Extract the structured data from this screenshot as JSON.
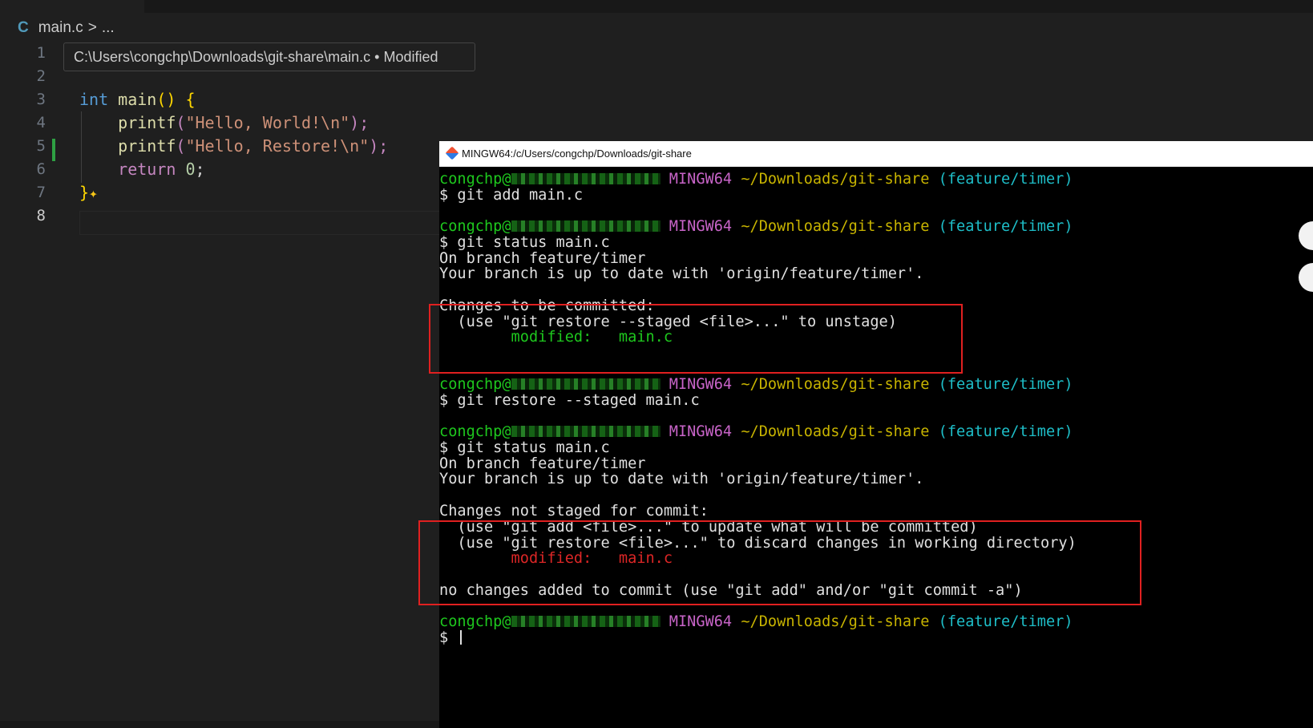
{
  "editor": {
    "breadcrumb": {
      "lang_icon": "C",
      "file": "main.c",
      "separator": ">",
      "ellipsis": "..."
    },
    "hover_tooltip": "C:\\Users\\congchp\\Downloads\\git-share\\main.c • Modified",
    "line_numbers": [
      "1",
      "2",
      "3",
      "4",
      "5",
      "6",
      "7",
      "8"
    ],
    "active_line": "8",
    "code": {
      "l3": {
        "kw": "int",
        "fn": "main",
        "rest": "() {"
      },
      "l4": {
        "fn": "printf",
        "open": "(",
        "str": "\"Hello, World!\\n\"",
        "close": ");"
      },
      "l5": {
        "fn": "printf",
        "open": "(",
        "str": "\"Hello, Restore!\\n\"",
        "close": ");"
      },
      "l6": {
        "kw": "return",
        "num": "0",
        "end": ";"
      },
      "l7": {
        "brace": "}",
        "sparkle_icon": "sparkle-icon"
      }
    }
  },
  "terminal": {
    "title": "MINGW64:/c/Users/congchp/Downloads/git-share",
    "prompt": {
      "user": "congchp@",
      "host_label": "MINGW64",
      "path": "~/Downloads/git-share",
      "branch": "(feature/timer)"
    },
    "lines": {
      "cmd1": "$ git add main.c",
      "cmd2": "$ git status main.c",
      "on_branch_1": "On branch feature/timer",
      "up_to_date_1": "Your branch is up to date with 'origin/feature/timer'.",
      "staged_header": "Changes to be committed:",
      "staged_hint": "  (use \"git restore --staged <file>...\" to unstage)",
      "staged_modified_label": "        modified:",
      "staged_modified_file": "   main.c",
      "cmd3": "$ git restore --staged main.c",
      "cmd4": "$ git status main.c",
      "on_branch_2": "On branch feature/timer",
      "up_to_date_2": "Your branch is up to date with 'origin/feature/timer'.",
      "unstaged_header": "Changes not staged for commit:",
      "unstaged_hint1": "  (use \"git add <file>...\" to update what will be committed)",
      "unstaged_hint2": "  (use \"git restore <file>...\" to discard changes in working directory)",
      "unstaged_modified_label": "        modified:",
      "unstaged_modified_file": "   main.c",
      "no_changes": "no changes added to commit (use \"git add\" and/or \"git commit -a\")",
      "final_prompt": "$ "
    }
  },
  "colors": {
    "prompt_user": "#1ec81e",
    "prompt_host": "#c864c8",
    "prompt_path": "#c8b400",
    "prompt_branch": "#1ebec8",
    "staged": "#1ec81e",
    "unstaged": "#dc2626",
    "highlight_box": "#e02020"
  }
}
